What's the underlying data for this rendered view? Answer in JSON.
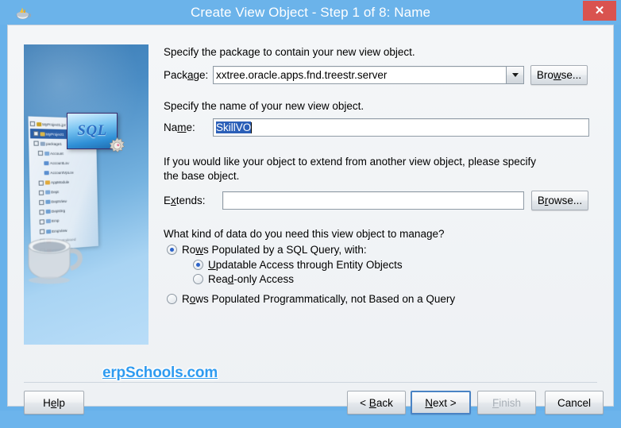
{
  "window": {
    "title": "Create View Object - Step 1 of 8: Name",
    "icon": "java-coffee-cup-icon",
    "close_label": "✕"
  },
  "side_image": {
    "sql_label": "SQL",
    "tree_items": [
      {
        "label": "MyProject1.jpr",
        "indent": 0,
        "selected": false,
        "icon": "project-icon"
      },
      {
        "label": "MyProject1",
        "indent": 1,
        "selected": true,
        "icon": "folder-icon"
      },
      {
        "label": "package1",
        "indent": 1,
        "selected": false,
        "icon": "package-icon"
      },
      {
        "label": "Account",
        "indent": 2,
        "selected": false,
        "icon": "entity-icon"
      },
      {
        "label": "AccountLov",
        "indent": 3,
        "selected": false,
        "icon": "view-icon"
      },
      {
        "label": "AccountVpLov",
        "indent": 3,
        "selected": false,
        "icon": "view-icon"
      },
      {
        "label": "AppModule",
        "indent": 2,
        "selected": false,
        "icon": "appmodule-icon"
      },
      {
        "label": "Dept",
        "indent": 2,
        "selected": false,
        "icon": "entity-icon"
      },
      {
        "label": "DeptView",
        "indent": 2,
        "selected": false,
        "icon": "view-icon"
      },
      {
        "label": "DeptOrg",
        "indent": 2,
        "selected": false,
        "icon": "view-icon"
      },
      {
        "label": "Emp",
        "indent": 2,
        "selected": false,
        "icon": "entity-icon"
      },
      {
        "label": "EmpView",
        "indent": 2,
        "selected": false,
        "icon": "view-icon"
      },
      {
        "label": "FldImpIndexed",
        "indent": 2,
        "selected": false,
        "icon": "link-icon"
      },
      {
        "label": "FldImpInLink",
        "indent": 2,
        "selected": false,
        "icon": "link-icon"
      }
    ]
  },
  "form": {
    "package_hint": "Specify the package to contain your new view object.",
    "package_label_pre": "Pack",
    "package_label_mn": "a",
    "package_label_post": "ge:",
    "package_value": "xxtree.oracle.apps.fnd.treestr.server",
    "package_browse_pre": "Bro",
    "package_browse_mn": "w",
    "package_browse_post": "se...",
    "name_hint": "Specify the name of your new view object.",
    "name_label_pre": "Na",
    "name_label_mn": "m",
    "name_label_post": "e:",
    "name_value": "SkillVO",
    "extends_hint_line1": "If you would like your object to extend from another view object, please specify",
    "extends_hint_line2": "the base object.",
    "extends_label_pre": "E",
    "extends_label_mn": "x",
    "extends_label_post": "tends:",
    "extends_value": "",
    "extends_browse_pre": "B",
    "extends_browse_mn": "r",
    "extends_browse_post": "owse...",
    "kind_question": "What kind of data do you need this view object to manage?",
    "radios": [
      {
        "pre": "Ro",
        "mn": "w",
        "post": "s Populated by a SQL Query, with:",
        "selected": true,
        "indent": 0
      },
      {
        "pre": "",
        "mn": "U",
        "post": "pdatable Access through Entity Objects",
        "selected": true,
        "indent": 1
      },
      {
        "pre": "Rea",
        "mn": "d",
        "post": "-only Access",
        "selected": false,
        "indent": 1
      },
      {
        "pre": "R",
        "mn": "o",
        "post": "ws Populated Programmatically, not Based on a Query",
        "selected": false,
        "indent": 0
      }
    ]
  },
  "footer": {
    "help_pre": "H",
    "help_mn": "e",
    "help_post": "lp",
    "watermark": "erpSchools.com",
    "back_pre": "< ",
    "back_mn": "B",
    "back_post": "ack",
    "next_pre": "",
    "next_mn": "N",
    "next_post": "ext >",
    "finish_pre": "",
    "finish_mn": "F",
    "finish_post": "inish",
    "cancel_label": "Cancel"
  },
  "colors": {
    "titlebar": "#6bb3ea",
    "close": "#d9534f",
    "accent_blue": "#2b5fb8",
    "watermark": "#2e9bf0"
  }
}
